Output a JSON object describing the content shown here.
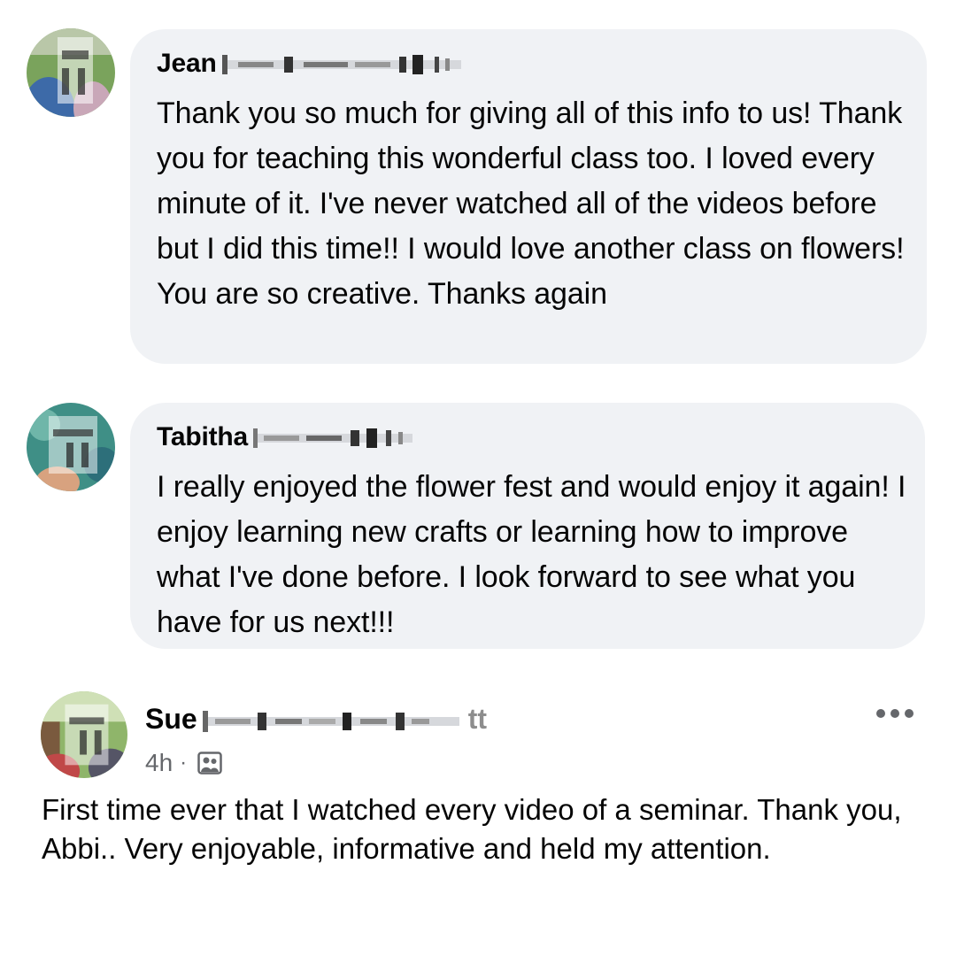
{
  "comments": [
    {
      "author": "Jean",
      "text": "Thank you so much for giving all of this info to us! Thank you for teaching this wonderful class too. I loved every minute of it. I've never watched all of the videos before but I did this time!! I would love another class on flowers! You are so creative. Thanks again"
    },
    {
      "author": "Tabitha",
      "text": "I really enjoyed the flower fest and would enjoy it again! I enjoy learning new crafts or learning how to improve what I've done before. I look forward to see what you have for us next!!!"
    }
  ],
  "post": {
    "author": "Sue",
    "name_tail": "tt",
    "time": "4h",
    "separator": "·",
    "audience_icon": "photo-audience-icon",
    "more_icon": "more-options-icon",
    "text": "First time ever that I watched every video of a seminar. Thank you, Abbi..  Very enjoyable, informative and held my attention."
  },
  "colors": {
    "bubble": "#f0f2f5",
    "text": "#050505",
    "meta": "#65676b"
  }
}
